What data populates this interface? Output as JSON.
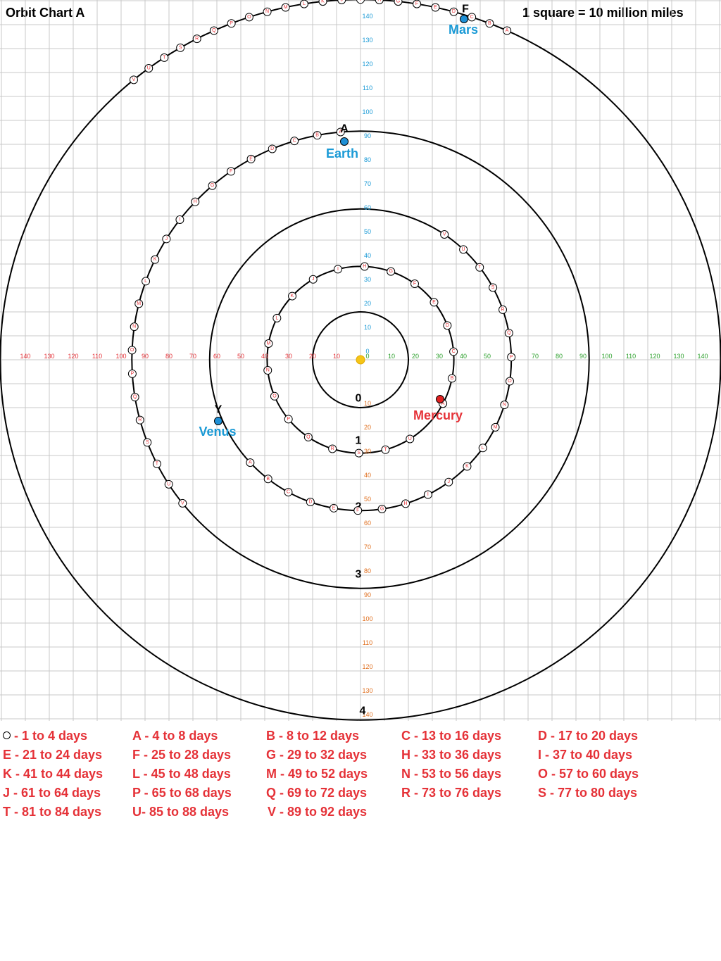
{
  "title": "Orbit Chart A",
  "scale_note": "1 square = 10 million miles",
  "colors": {
    "grid": "#c8c8c8",
    "orbit": "#000000",
    "sun": "#f5c518",
    "planet_blue": "#1e90d6",
    "planet_red": "#e02020",
    "label_blue": "#1a9ad6",
    "label_red": "#e53238",
    "axis_left": "#e53238",
    "axis_right": "#2ca02c",
    "axis_up": "#1a9ad6",
    "axis_down": "#e07020",
    "legend_text": "#e53238"
  },
  "axes": {
    "left": [
      "140",
      "130",
      "120",
      "110",
      "100",
      "90",
      "80",
      "70",
      "60",
      "50",
      "40",
      "30",
      "20",
      "10"
    ],
    "right": [
      "0",
      "10",
      "20",
      "30",
      "40",
      "50",
      "60",
      "70",
      "80",
      "90",
      "100",
      "110",
      "120",
      "130",
      "140"
    ],
    "up": [
      "0",
      "10",
      "20",
      "30",
      "40",
      "50",
      "60",
      "70",
      "80",
      "90",
      "100",
      "110",
      "120",
      "130",
      "140"
    ],
    "down": [
      "10",
      "20",
      "30",
      "40",
      "50",
      "60",
      "70",
      "80",
      "90",
      "100",
      "110",
      "120",
      "130",
      "140"
    ]
  },
  "orbit_labels": [
    "0",
    "1",
    "2",
    "3",
    "4"
  ],
  "planets": {
    "mercury": {
      "name": "Mercury"
    },
    "venus": {
      "name": "Venus",
      "marker": "Y"
    },
    "earth": {
      "name": "Earth",
      "marker": "A"
    },
    "mars": {
      "name": "Mars",
      "marker": "F"
    }
  },
  "position_markers": {
    "mercury": [
      "A",
      "B",
      "C",
      "D",
      "E",
      "F",
      "G",
      "H",
      "I",
      "J",
      "K",
      "L",
      "M",
      "N",
      "O",
      "P",
      "Q",
      "R",
      "S",
      "T",
      "U"
    ],
    "venus": [
      "A",
      "B",
      "C",
      "D",
      "E",
      "F",
      "G",
      "H",
      "I",
      "J",
      "K",
      "L",
      "M",
      "N",
      "O",
      "P",
      "Q",
      "R",
      "S",
      "T",
      "U",
      "V"
    ],
    "earth": [
      "A",
      "B",
      "C",
      "D",
      "E",
      "F",
      "G",
      "H",
      "I",
      "J",
      "K",
      "L",
      "M",
      "N",
      "O",
      "P",
      "Q",
      "R",
      "S",
      "T",
      "U",
      "V"
    ],
    "mars": [
      "A",
      "B",
      "C",
      "D",
      "E",
      "F",
      "G",
      "H",
      "I",
      "J",
      "K",
      "L",
      "M",
      "N",
      "O",
      "P",
      "Q",
      "R",
      "S",
      "T",
      "U",
      "V"
    ]
  },
  "legend": [
    "- 1 to 4 days",
    "A - 4 to 8 days",
    "B - 8 to 12 days",
    "C - 13 to 16 days",
    "D - 17 to 20 days",
    "E - 21 to 24 days",
    "F - 25 to 28 days",
    "G - 29 to 32 days",
    "H - 33 to 36 days",
    "I - 37 to 40 days",
    "K - 41 to 44 days",
    "L - 45 to 48 days",
    "M - 49 to 52 days",
    "N - 53 to 56 days",
    "O - 57 to 60 days",
    "J - 61 to 64 days",
    "P - 65 to 68 days",
    "Q - 69 to 72 days",
    "R - 73 to 76 days",
    "S - 77 to 80 days",
    "T - 81 to 84 days",
    "U- 85 to 88 days",
    "V - 89 to 92 days"
  ]
}
